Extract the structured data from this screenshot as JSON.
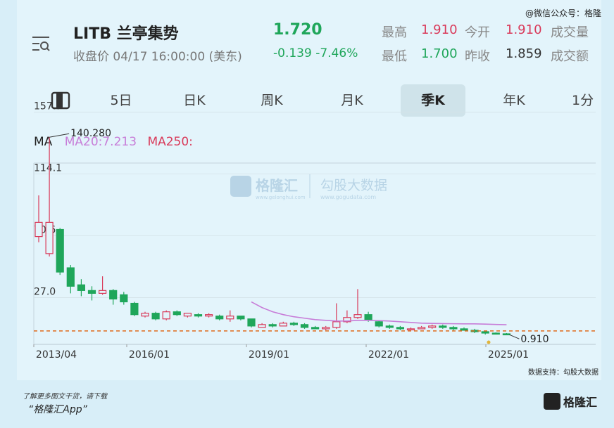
{
  "watermark_top": "@微信公众号：格隆",
  "header": {
    "ticker": "LITB 兰亭集势",
    "price": "1.720",
    "close_info": "收盘价 04/17 16:00:00 (美东)",
    "change": "-0.139 -7.46%",
    "stats": [
      {
        "label": "最高",
        "value": "1.910",
        "color": "#d93a5a"
      },
      {
        "label": "今开",
        "value": "1.910",
        "color": "#d93a5a"
      },
      {
        "label": "成交量",
        "value": ""
      },
      {
        "label": "最低",
        "value": "1.700",
        "color": "#1fa65a"
      },
      {
        "label": "昨收",
        "value": "1.859",
        "color": "#333333"
      },
      {
        "label": "成交额",
        "value": ""
      }
    ]
  },
  "tabs": [
    "5日",
    "日K",
    "周K",
    "月K",
    "季K",
    "年K",
    "1分"
  ],
  "active_tab": "季K",
  "ma": {
    "label": "MA",
    "ma20": "MA20:7.213",
    "ma250": "MA250:"
  },
  "watermark": {
    "brand": "格隆汇",
    "brand_url": "www.gelonghui.com",
    "gogu": "勾股大数据",
    "gogu_url": "www.gogudata.com"
  },
  "footer": {
    "note": "了解更多图文干货，请下载",
    "app": "“格隆汇App”",
    "support": "数据支持：勾股大数据",
    "logo_text": "格隆汇"
  },
  "colors": {
    "up": "#d93a5a",
    "down": "#1fa65a",
    "ma20": "#c77dd8",
    "ref_line": "#e06a1a"
  },
  "chart_data": {
    "type": "candlestick",
    "y_ticks": [
      157.7,
      114.1,
      70.6,
      27.0
    ],
    "x_labels": [
      "2013/04",
      "2016/01",
      "2019/01",
      "2022/01",
      "2025/01"
    ],
    "high_annotation": "140.280",
    "last_annotation": "0.910",
    "reference_value": 3.5,
    "candles": [
      {
        "o": 70,
        "c": 80,
        "h": 99,
        "l": 66
      },
      {
        "o": 58,
        "c": 80,
        "h": 140,
        "l": 56
      },
      {
        "o": 75,
        "c": 45,
        "h": 76,
        "l": 43
      },
      {
        "o": 48,
        "c": 35,
        "h": 50,
        "l": 30
      },
      {
        "o": 36,
        "c": 32,
        "h": 40,
        "l": 28
      },
      {
        "o": 32,
        "c": 30,
        "h": 35,
        "l": 25
      },
      {
        "o": 30,
        "c": 32,
        "h": 42,
        "l": 29
      },
      {
        "o": 32,
        "c": 26,
        "h": 33,
        "l": 22
      },
      {
        "o": 29,
        "c": 24,
        "h": 31,
        "l": 22
      },
      {
        "o": 23,
        "c": 15,
        "h": 24,
        "l": 14
      },
      {
        "o": 14,
        "c": 16,
        "h": 17,
        "l": 13
      },
      {
        "o": 16,
        "c": 12,
        "h": 17,
        "l": 11
      },
      {
        "o": 12,
        "c": 17,
        "h": 18,
        "l": 11
      },
      {
        "o": 17,
        "c": 15,
        "h": 18,
        "l": 14
      },
      {
        "o": 14,
        "c": 16,
        "h": 16,
        "l": 13
      },
      {
        "o": 15,
        "c": 14,
        "h": 16,
        "l": 13
      },
      {
        "o": 14,
        "c": 15,
        "h": 16,
        "l": 13
      },
      {
        "o": 14,
        "c": 12,
        "h": 15,
        "l": 11
      },
      {
        "o": 12,
        "c": 14,
        "h": 18,
        "l": 10
      },
      {
        "o": 14,
        "c": 12,
        "h": 14,
        "l": 11
      },
      {
        "o": 12,
        "c": 7,
        "h": 12,
        "l": 6
      },
      {
        "o": 6,
        "c": 8,
        "h": 9,
        "l": 6
      },
      {
        "o": 8,
        "c": 7,
        "h": 9,
        "l": 6
      },
      {
        "o": 7,
        "c": 9,
        "h": 10,
        "l": 7
      },
      {
        "o": 9,
        "c": 8,
        "h": 10,
        "l": 7
      },
      {
        "o": 8,
        "c": 6,
        "h": 9,
        "l": 5
      },
      {
        "o": 6,
        "c": 5,
        "h": 7,
        "l": 5
      },
      {
        "o": 5,
        "c": 6,
        "h": 7,
        "l": 4
      },
      {
        "o": 6,
        "c": 10,
        "h": 23,
        "l": 5
      },
      {
        "o": 10,
        "c": 13,
        "h": 18,
        "l": 9
      },
      {
        "o": 13,
        "c": 15,
        "h": 33,
        "l": 12
      },
      {
        "o": 15,
        "c": 11,
        "h": 17,
        "l": 10
      },
      {
        "o": 10,
        "c": 7,
        "h": 11,
        "l": 6
      },
      {
        "o": 7,
        "c": 6,
        "h": 8,
        "l": 5
      },
      {
        "o": 6,
        "c": 5,
        "h": 7,
        "l": 4
      },
      {
        "o": 5,
        "c": 5,
        "h": 6,
        "l": 4
      },
      {
        "o": 5,
        "c": 6,
        "h": 7,
        "l": 5
      },
      {
        "o": 6,
        "c": 7,
        "h": 8,
        "l": 5
      },
      {
        "o": 7,
        "c": 6,
        "h": 8,
        "l": 5
      },
      {
        "o": 6,
        "c": 5,
        "h": 7,
        "l": 4
      },
      {
        "o": 5,
        "c": 4,
        "h": 6,
        "l": 4
      },
      {
        "o": 4,
        "c": 3,
        "h": 5,
        "l": 2
      },
      {
        "o": 3,
        "c": 2,
        "h": 3,
        "l": 1
      },
      {
        "o": 2,
        "c": 1.5,
        "h": 2.5,
        "l": 1
      },
      {
        "o": 1.5,
        "c": 0.9,
        "h": 2,
        "l": 0.8
      }
    ],
    "ma20": {
      "start_index": 20,
      "values": [
        24,
        20,
        17,
        15,
        13.5,
        12.5,
        11.5,
        11,
        10.5,
        10.5,
        11,
        11,
        10.8,
        10.5,
        10,
        9.5,
        9,
        8.8,
        8.7,
        8.6,
        8.5,
        8.5,
        8.3,
        8.1,
        7.9
      ]
    }
  }
}
